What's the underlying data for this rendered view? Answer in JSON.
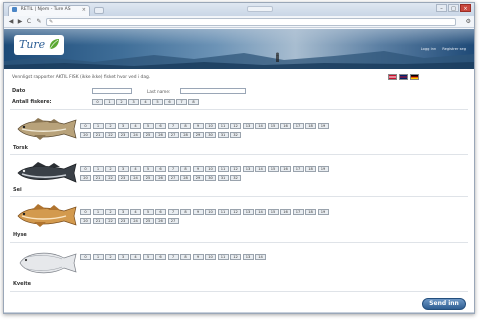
{
  "browser": {
    "tab_title": "RETIL | Njem - Ture AS",
    "tab_close": "×",
    "new_tab": "",
    "window_controls": {
      "minimize": "–",
      "maximize": "□",
      "close": "×"
    },
    "nav": {
      "back": "◀",
      "forward": "▶",
      "reload": "C",
      "page": "✎"
    },
    "omnibox_icon": "✎",
    "menu_icon": "wrench-icon"
  },
  "header": {
    "logo_text": "Ture",
    "links": [
      "Logg inn",
      "Registrer seg"
    ]
  },
  "intro_text": "Vennligst rapporter AKTIL FISK (ikke ikke) fisket hvor ved i dag.",
  "flags": [
    {
      "name": "norway-flag",
      "colors": [
        "#c8102e",
        "#ffffff",
        "#00205b"
      ]
    },
    {
      "name": "uk-flag",
      "colors": [
        "#012169",
        "#ffffff",
        "#c8102e"
      ]
    },
    {
      "name": "germany-flag",
      "colors": [
        "#000000",
        "#dd0000",
        "#ffce00"
      ]
    }
  ],
  "form": {
    "date_label": "Dato",
    "last_name_label": "Last name:",
    "count_label": "Antall fiskere:",
    "fisher_counts": [
      "0",
      "1",
      "2",
      "3",
      "4",
      "5",
      "6",
      "7",
      "8"
    ]
  },
  "species": [
    {
      "name": "Torsk",
      "numbers": [
        "0",
        "1",
        "2",
        "3",
        "4",
        "5",
        "6",
        "7",
        "8",
        "9",
        "10",
        "11",
        "12",
        "13",
        "14",
        "15",
        "16",
        "17",
        "18",
        "19",
        "20",
        "21",
        "22",
        "23",
        "24",
        "25",
        "26",
        "27",
        "28",
        "29",
        "30",
        "31",
        "32"
      ]
    },
    {
      "name": "Sei",
      "numbers": [
        "0",
        "1",
        "2",
        "3",
        "4",
        "5",
        "6",
        "7",
        "8",
        "9",
        "10",
        "11",
        "12",
        "13",
        "14",
        "15",
        "16",
        "17",
        "18",
        "19",
        "20",
        "21",
        "22",
        "23",
        "24",
        "25",
        "26",
        "27",
        "28",
        "29",
        "30",
        "31",
        "32"
      ]
    },
    {
      "name": "Hyse",
      "numbers": [
        "0",
        "1",
        "2",
        "3",
        "4",
        "5",
        "6",
        "7",
        "8",
        "9",
        "10",
        "11",
        "12",
        "13",
        "14",
        "15",
        "16",
        "17",
        "18",
        "19",
        "20",
        "21",
        "22",
        "23",
        "24",
        "25",
        "26",
        "27"
      ]
    },
    {
      "name": "Kveite",
      "numbers": [
        "0",
        "1",
        "2",
        "3",
        "4",
        "5",
        "6",
        "7",
        "8",
        "9",
        "10",
        "11",
        "12",
        "13",
        "14"
      ]
    }
  ],
  "send_label": "Send inn",
  "colors": {
    "accent": "#2e5e92",
    "button_bg": "#e9edf1"
  }
}
